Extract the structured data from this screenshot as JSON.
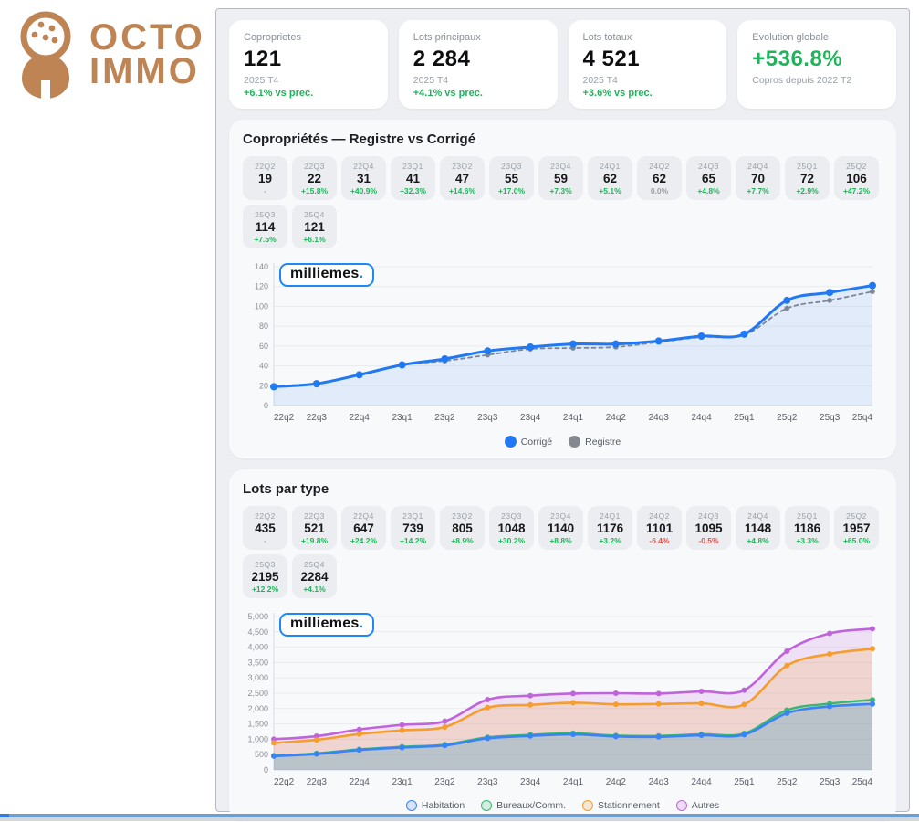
{
  "brand": {
    "line1": "OCTO",
    "line2": "IMMO",
    "color": "#bf8454"
  },
  "kpis": [
    {
      "label": "Coproprietes",
      "value": "121",
      "sub": "2025 T4",
      "delta": "+6.1% vs prec."
    },
    {
      "label": "Lots principaux",
      "value": "2 284",
      "sub": "2025 T4",
      "delta": "+4.1% vs prec."
    },
    {
      "label": "Lots totaux",
      "value": "4 521",
      "sub": "2025 T4",
      "delta": "+3.6% vs prec."
    },
    {
      "label": "Evolution globale",
      "value": "+536.8%",
      "sub": "Copros depuis 2022 T2",
      "delta": ""
    }
  ],
  "panel1": {
    "title": "Copropriétés — Registre vs Corrigé",
    "watermark": {
      "text": "milliemes",
      "suffix": "."
    },
    "chips": [
      {
        "q": "22Q2",
        "v": "19",
        "d": "-",
        "tone": "muted"
      },
      {
        "q": "22Q3",
        "v": "22",
        "d": "+15.8%",
        "tone": "up"
      },
      {
        "q": "22Q4",
        "v": "31",
        "d": "+40.9%",
        "tone": "up"
      },
      {
        "q": "23Q1",
        "v": "41",
        "d": "+32.3%",
        "tone": "up"
      },
      {
        "q": "23Q2",
        "v": "47",
        "d": "+14.6%",
        "tone": "up"
      },
      {
        "q": "23Q3",
        "v": "55",
        "d": "+17.0%",
        "tone": "up"
      },
      {
        "q": "23Q4",
        "v": "59",
        "d": "+7.3%",
        "tone": "up"
      },
      {
        "q": "24Q1",
        "v": "62",
        "d": "+5.1%",
        "tone": "up"
      },
      {
        "q": "24Q2",
        "v": "62",
        "d": "0.0%",
        "tone": "muted"
      },
      {
        "q": "24Q3",
        "v": "65",
        "d": "+4.8%",
        "tone": "up"
      },
      {
        "q": "24Q4",
        "v": "70",
        "d": "+7.7%",
        "tone": "up"
      },
      {
        "q": "25Q1",
        "v": "72",
        "d": "+2.9%",
        "tone": "up"
      },
      {
        "q": "25Q2",
        "v": "106",
        "d": "+47.2%",
        "tone": "up"
      },
      {
        "q": "25Q3",
        "v": "114",
        "d": "+7.5%",
        "tone": "up"
      },
      {
        "q": "25Q4",
        "v": "121",
        "d": "+6.1%",
        "tone": "up"
      }
    ],
    "chart_data": {
      "type": "line",
      "categories": [
        "22q2",
        "22q3",
        "22q4",
        "23q1",
        "23q2",
        "23q3",
        "23q4",
        "24q1",
        "24q2",
        "24q3",
        "24q4",
        "25q1",
        "25q2",
        "25q3",
        "25q4"
      ],
      "series": [
        {
          "name": "Corrigé",
          "color": "#2079f3",
          "width": 3,
          "marker": 4,
          "fill": true,
          "fill_opacity": 0.1,
          "dashed": false,
          "values": [
            19,
            22,
            31,
            41,
            47,
            55,
            59,
            62,
            62,
            65,
            70,
            72,
            106,
            114,
            121
          ]
        },
        {
          "name": "Registre",
          "color": "#85898f",
          "width": 1.8,
          "marker": 2.8,
          "fill": false,
          "fill_opacity": 0,
          "dashed": true,
          "values": [
            19,
            22,
            31,
            41,
            45,
            51,
            57,
            58,
            59,
            64,
            69,
            71,
            98,
            106,
            115
          ]
        }
      ],
      "ylim": [
        0,
        140
      ],
      "ytick_step": 20,
      "ytick_format": "plain",
      "grid": true,
      "legend_position": "bottom",
      "legend_style": "filled",
      "title": "Copropriétés — Registre vs Corrigé",
      "xlabel": "",
      "ylabel": ""
    }
  },
  "panel2": {
    "title": "Lots par type",
    "watermark": {
      "text": "milliemes",
      "suffix": "."
    },
    "chips": [
      {
        "q": "22Q2",
        "v": "435",
        "d": "-",
        "tone": "muted"
      },
      {
        "q": "22Q3",
        "v": "521",
        "d": "+19.8%",
        "tone": "up"
      },
      {
        "q": "22Q4",
        "v": "647",
        "d": "+24.2%",
        "tone": "up"
      },
      {
        "q": "23Q1",
        "v": "739",
        "d": "+14.2%",
        "tone": "up"
      },
      {
        "q": "23Q2",
        "v": "805",
        "d": "+8.9%",
        "tone": "up"
      },
      {
        "q": "23Q3",
        "v": "1048",
        "d": "+30.2%",
        "tone": "up"
      },
      {
        "q": "23Q4",
        "v": "1140",
        "d": "+8.8%",
        "tone": "up"
      },
      {
        "q": "24Q1",
        "v": "1176",
        "d": "+3.2%",
        "tone": "up"
      },
      {
        "q": "24Q2",
        "v": "1101",
        "d": "-6.4%",
        "tone": "down"
      },
      {
        "q": "24Q3",
        "v": "1095",
        "d": "-0.5%",
        "tone": "down"
      },
      {
        "q": "24Q4",
        "v": "1148",
        "d": "+4.8%",
        "tone": "up"
      },
      {
        "q": "25Q1",
        "v": "1186",
        "d": "+3.3%",
        "tone": "up"
      },
      {
        "q": "25Q2",
        "v": "1957",
        "d": "+65.0%",
        "tone": "up"
      },
      {
        "q": "25Q3",
        "v": "2195",
        "d": "+12.2%",
        "tone": "up"
      },
      {
        "q": "25Q4",
        "v": "2284",
        "d": "+4.1%",
        "tone": "up"
      }
    ],
    "chart_data": {
      "type": "area",
      "categories": [
        "22q2",
        "22q3",
        "22q4",
        "23q1",
        "23q2",
        "23q3",
        "23q4",
        "24q1",
        "24q2",
        "24q3",
        "24q4",
        "25q1",
        "25q2",
        "25q3",
        "25q4"
      ],
      "series": [
        {
          "name": "Habitation",
          "color": "#3b82f6",
          "width": 2.6,
          "marker": 3,
          "fill": true,
          "fill_opacity": 0.16,
          "dashed": false,
          "values": [
            450,
            520,
            650,
            730,
            800,
            1030,
            1110,
            1160,
            1090,
            1080,
            1130,
            1150,
            1850,
            2070,
            2150
          ]
        },
        {
          "name": "Bureaux/Comm.",
          "color": "#35b871",
          "width": 2.4,
          "marker": 3,
          "fill": true,
          "fill_opacity": 0.14,
          "dashed": false,
          "values": [
            465,
            540,
            670,
            755,
            825,
            1065,
            1145,
            1195,
            1120,
            1110,
            1165,
            1190,
            1950,
            2160,
            2284
          ]
        },
        {
          "name": "Stationnement",
          "color": "#f59d2d",
          "width": 2.6,
          "marker": 3,
          "fill": true,
          "fill_opacity": 0.18,
          "dashed": false,
          "values": [
            880,
            980,
            1170,
            1290,
            1400,
            2030,
            2120,
            2190,
            2140,
            2150,
            2170,
            2130,
            3400,
            3780,
            3950
          ]
        },
        {
          "name": "Autres",
          "color": "#bf64db",
          "width": 2.6,
          "marker": 3,
          "fill": true,
          "fill_opacity": 0.16,
          "dashed": false,
          "values": [
            1000,
            1100,
            1320,
            1470,
            1590,
            2290,
            2420,
            2490,
            2500,
            2490,
            2560,
            2600,
            3870,
            4450,
            4600
          ]
        }
      ],
      "ylim": [
        0,
        5000
      ],
      "ytick_step": 500,
      "ytick_format": "thousands",
      "grid": true,
      "legend_position": "bottom",
      "legend_style": "outline",
      "title": "Lots par type",
      "xlabel": "",
      "ylabel": ""
    }
  }
}
